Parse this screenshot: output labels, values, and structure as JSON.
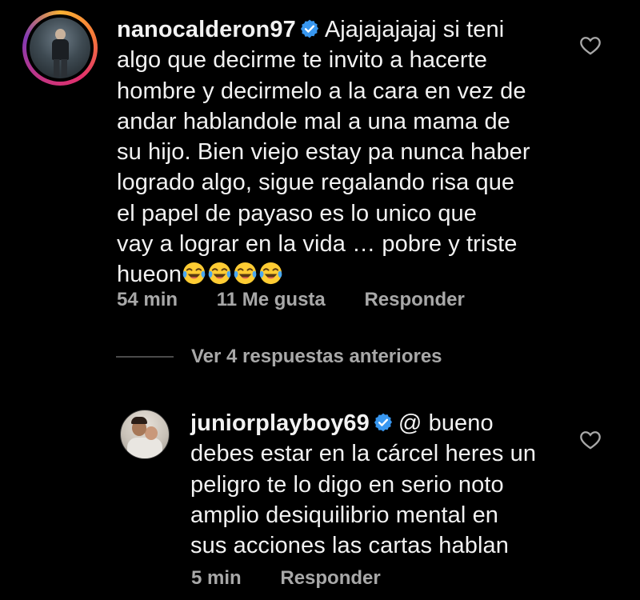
{
  "comment1": {
    "username": "nanocalderon97",
    "verified": true,
    "avatar_icon": "user-photo-icon",
    "text_lines": [
      "Ajajajajajaj si teni",
      "algo que decirme te invito a hacerte",
      "hombre y decirmelo a la cara en vez de",
      "andar hablandole mal a una mama de",
      "su hijo. Bien viejo estay pa nunca haber",
      "logrado algo, sigue regalando risa que",
      "el papel de payaso es lo unico que",
      "vay a lograr en la vida … pobre y triste",
      "hueon"
    ],
    "emoji_icon": "tears-of-joy-emoji",
    "emoji_count": 4,
    "time": "54 min",
    "likes": "11 Me gusta",
    "reply_label": "Responder",
    "like_icon": "heart-outline-icon"
  },
  "replies_toggle": {
    "label": "Ver 4 respuestas anteriores"
  },
  "comment2": {
    "username": "juniorplayboy69",
    "verified": true,
    "avatar_icon": "user-photo-icon",
    "text_lines": [
      "@ bueno",
      "debes estar en la cárcel heres un",
      "peligro te lo digo en serio  noto",
      "amplio desiquilibrio mental en",
      "sus acciones las cartas hablan"
    ],
    "time": "5 min",
    "reply_label": "Responder",
    "like_icon": "heart-outline-icon"
  },
  "colors": {
    "background": "#000000",
    "text": "#f2f2f2",
    "meta": "#a8a8a8",
    "verified": "#3897f0",
    "avatar_ring": "#e1306c"
  }
}
